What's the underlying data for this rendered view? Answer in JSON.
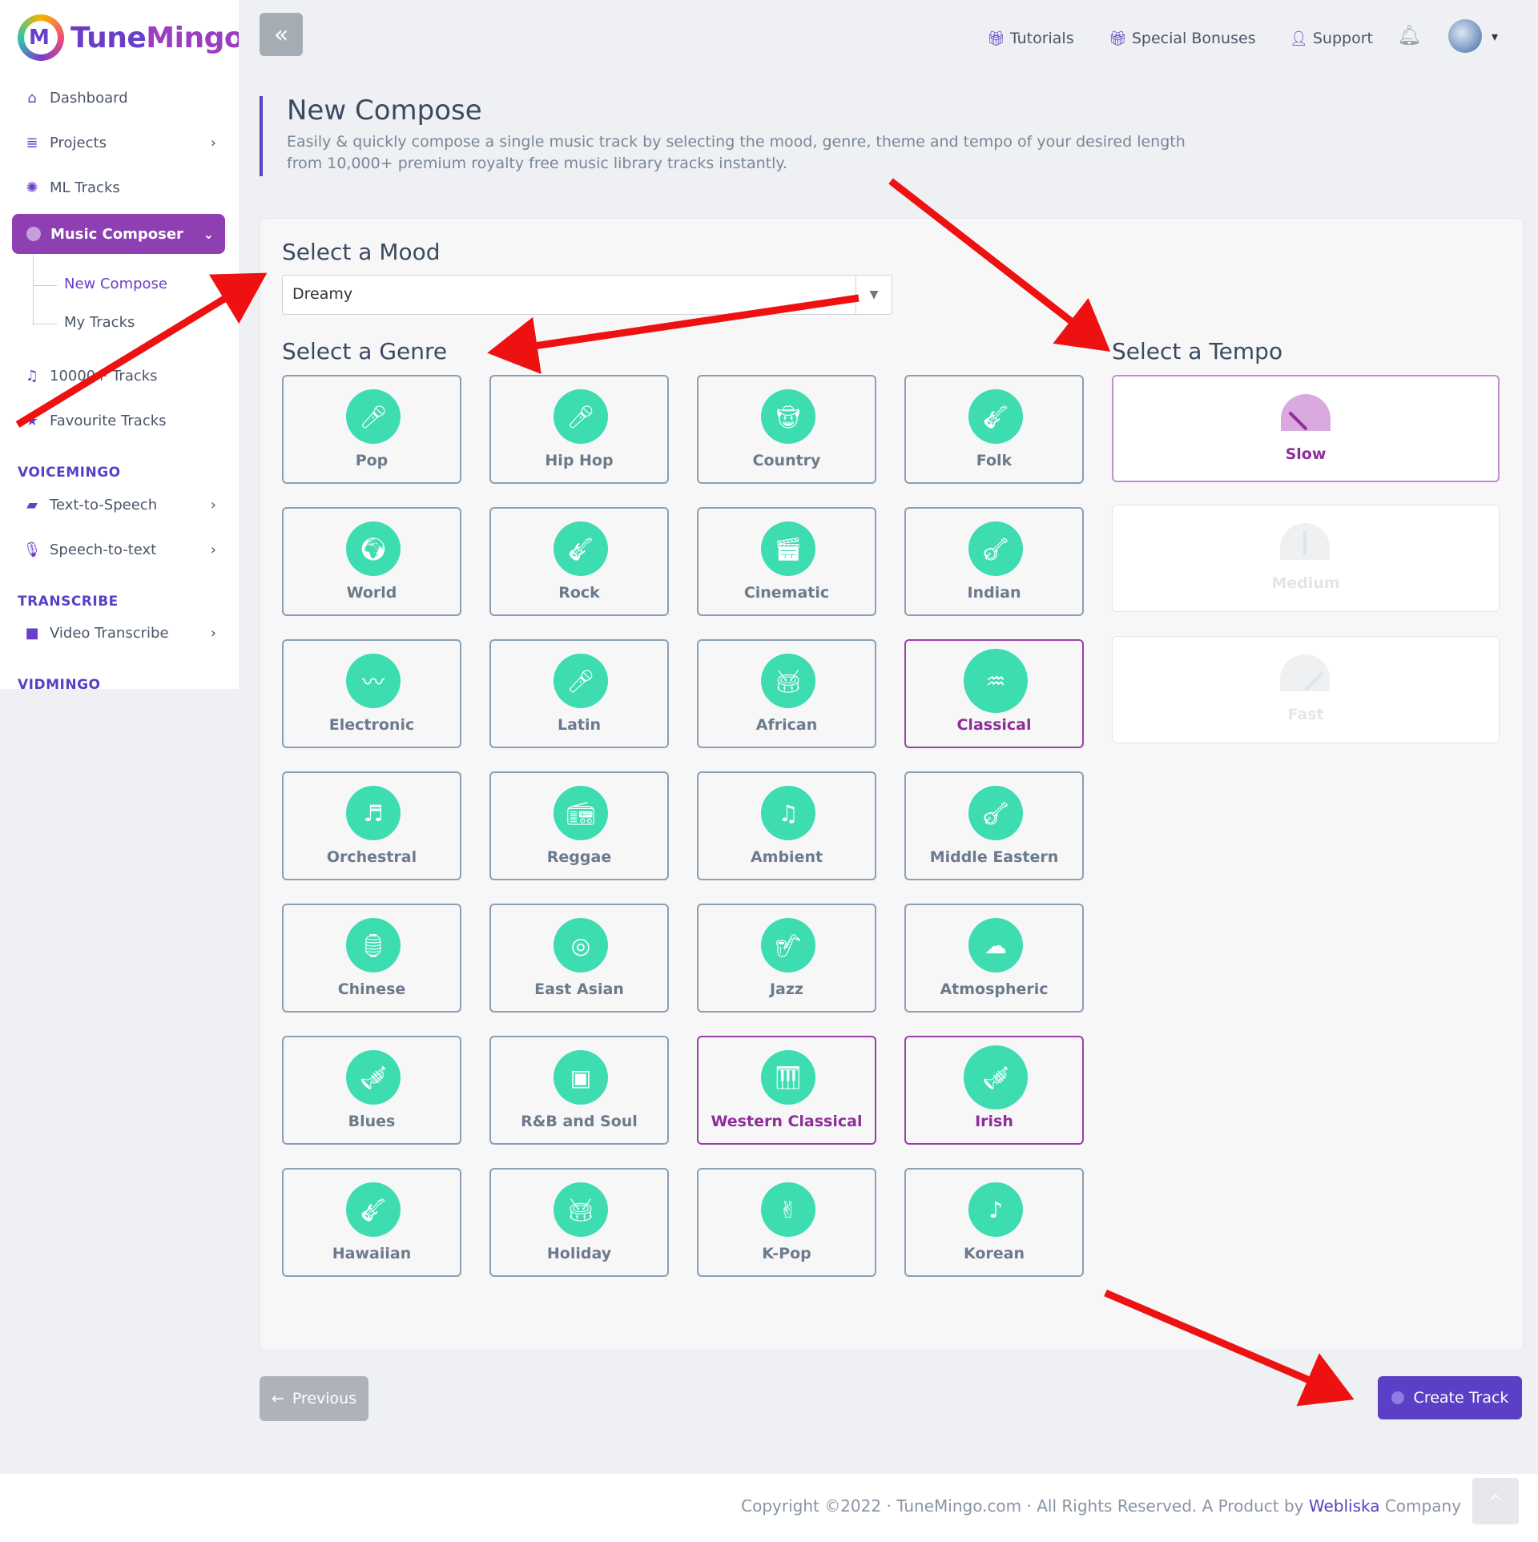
{
  "brand": {
    "logo_letter": "M",
    "name_part1": "Tune",
    "name_part2": "Mingo"
  },
  "sidebar": {
    "items": [
      {
        "label": "Dashboard",
        "icon": "home-icon"
      },
      {
        "label": "Projects",
        "icon": "layers-icon"
      },
      {
        "label": "ML Tracks",
        "icon": "atom-icon"
      },
      {
        "label": "Music Composer",
        "icon": "disc-icon"
      },
      {
        "label": "10000+ Tracks",
        "icon": "playlist-icon"
      },
      {
        "label": "Favourite Tracks",
        "icon": "star-icon"
      }
    ],
    "sub_items": [
      "New Compose",
      "My Tracks"
    ],
    "sections": {
      "voicemingo": "VOICEMINGO",
      "transcribe": "TRANSCRIBE",
      "vidmingo": "VIDMINGO"
    },
    "voicemingo_items": [
      "Text-to-Speech",
      "Speech-to-text"
    ],
    "transcribe_items": [
      "Video Transcribe"
    ]
  },
  "header": {
    "tutorials": "Tutorials",
    "bonuses": "Special Bonuses",
    "support": "Support"
  },
  "page": {
    "title": "New Compose",
    "description": "Easily & quickly compose a single music track by selecting the mood, genre, theme and tempo of your desired length from 10,000+ premium royalty free music library tracks instantly."
  },
  "form": {
    "mood_label": "Select a Mood",
    "mood_value": "Dreamy",
    "genre_label": "Select a Genre",
    "tempo_label": "Select a Tempo",
    "genres": [
      "Pop",
      "Hip Hop",
      "Country",
      "Folk",
      "World",
      "Rock",
      "Cinematic",
      "Indian",
      "Electronic",
      "Latin",
      "African",
      "Classical",
      "Orchestral",
      "Reggae",
      "Ambient",
      "Middle Eastern",
      "Chinese",
      "East Asian",
      "Jazz",
      "Atmospheric",
      "Blues",
      "R&B and Soul",
      "Western Classical",
      "Irish",
      "Hawaiian",
      "Holiday",
      "K-Pop",
      "Korean"
    ],
    "selected_genres": [
      "Classical",
      "Western Classical",
      "Irish"
    ],
    "tempos": [
      "Slow",
      "Medium",
      "Fast"
    ],
    "selected_tempo": "Slow"
  },
  "buttons": {
    "previous": "Previous",
    "create": "Create Track"
  },
  "footer": {
    "copyright": "Copyright ©2022 · TuneMingo.com · All Rights Reserved. A Product by ",
    "company_link": "Webliska",
    "company_suffix": " Company"
  },
  "colors": {
    "accent": "#5b3fc6",
    "active_nav": "#8e3fb2",
    "genre_icon": "#3ddcb1",
    "annotation_arrow": "#ee1111"
  }
}
